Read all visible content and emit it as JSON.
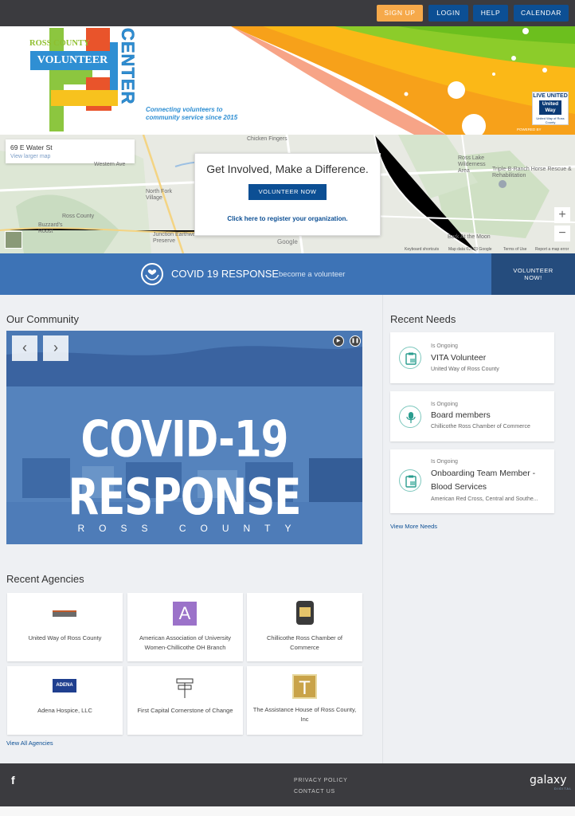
{
  "nav": {
    "signup": "SIGN UP",
    "login": "LOGIN",
    "help": "HELP",
    "calendar": "CALENDAR"
  },
  "banner": {
    "logo_county": "ROSS COUNTY",
    "logo_volunteer": "VOLUNTEER",
    "logo_center": "CENTER",
    "tagline_1": "Connecting volunteers to",
    "tagline_2": "community service since 2015",
    "badge_top": "LIVE UNITED",
    "badge_uw": "United Way",
    "badge_sub": "United Way of Ross County",
    "powered": "POWERED BY"
  },
  "map": {
    "address": "69 E Water St",
    "larger_map": "View larger map",
    "labels": [
      "Chicken Fingers",
      "Western Ave",
      "North Fork Village",
      "Ross County",
      "Buzzard's Roost",
      "Junction Earthworks Preserve",
      "Ross Lake Wilderness Area",
      "Triple-B-Ranch Horse Rescue & Rehabilitation",
      "Bark At the Moon"
    ],
    "footer": [
      "Keyboard shortcuts",
      "Map data ©2023 Google",
      "Terms of Use",
      "Report a map error"
    ],
    "google": "Google",
    "zoom_in": "+",
    "zoom_out": "−"
  },
  "cta": {
    "title": "Get Involved, Make a Difference.",
    "button": "VOLUNTEER NOW",
    "register": "Click here to register your organization."
  },
  "covid": {
    "title": "COVID 19 RESPONSE",
    "subtitle": "become a volunteer",
    "button_1": "VOLUNTEER",
    "button_2": "NOW!"
  },
  "community": {
    "heading": "Our Community",
    "slide_title": "COVID-19 RESPONSE",
    "slide_sub": "ROSS COUNTY",
    "prev": "‹",
    "next": "›",
    "play": "▶",
    "pause": "❚❚"
  },
  "needs": {
    "heading": "Recent Needs",
    "items": [
      {
        "status": "Is Ongoing",
        "title": "VITA Volunteer",
        "org": "United Way of Ross County"
      },
      {
        "status": "Is Ongoing",
        "title": "Board members",
        "org": "Chillicothe Ross Chamber of Commerce"
      },
      {
        "status": "Is Ongoing",
        "title": "Onboarding Team Member - Blood Services",
        "org": "American Red Cross, Central and Southe..."
      }
    ],
    "view_more": "View More Needs"
  },
  "agencies": {
    "heading": "Recent Agencies",
    "items": [
      {
        "name": "United Way of Ross County"
      },
      {
        "name": "American Association of University Women-Chillicothe OH Branch",
        "logo_letter": "A"
      },
      {
        "name": "Chillicothe Ross Chamber of Commerce"
      },
      {
        "name": "Adena Hospice, LLC",
        "logo_text": "ADENA"
      },
      {
        "name": "First Capital Cornerstone of Change"
      },
      {
        "name": "The Assistance House of Ross County, Inc",
        "logo_letter": "T"
      }
    ],
    "view_all": "View All Agencies"
  },
  "footer": {
    "facebook": "f",
    "privacy": "PRIVACY POLICY",
    "contact": "CONTACT US",
    "brand": "galaxy",
    "brand_sub": "DIGITAL"
  },
  "colors": {
    "nav_bg": "#3b3b3f",
    "primary": "#0c4f94",
    "signup": "#f6a94a",
    "covid_bar": "#3d73b6",
    "covid_button": "#254c7d",
    "page_bg": "#eef0f3",
    "need_icon_border": "#7ec8be"
  }
}
